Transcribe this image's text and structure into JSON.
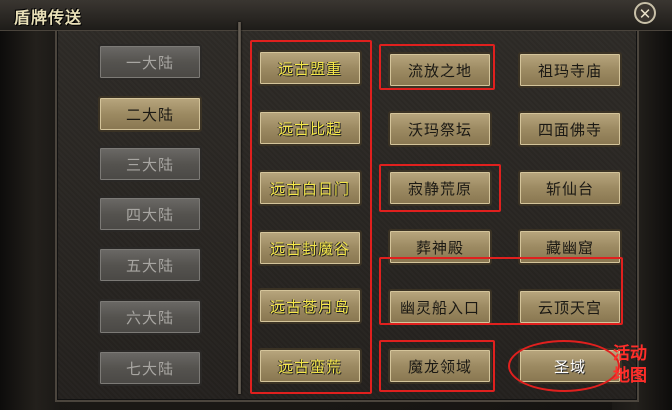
{
  "window": {
    "title": "盾牌传送",
    "close_glyph": "✕"
  },
  "continents": [
    "一大陆",
    "二大陆",
    "三大陆",
    "四大陆",
    "五大陆",
    "六大陆",
    "七大陆"
  ],
  "ancient": [
    "远古盟重",
    "远古比起",
    "远古白日门",
    "远古封魔谷",
    "远古苍月岛",
    "远古蛮荒"
  ],
  "maps_left": [
    "流放之地",
    "沃玛祭坛",
    "寂静荒原",
    "葬神殿",
    "幽灵船入口",
    "魔龙领域"
  ],
  "maps_right": [
    "祖玛寺庙",
    "四面佛寺",
    "斩仙台",
    "藏幽窟",
    "云顶天宫",
    "圣域"
  ],
  "annotation": {
    "line1": "活动",
    "line2": "地图"
  },
  "colors": {
    "highlight": "#e0201e",
    "selected_text": "#f6e84a"
  }
}
